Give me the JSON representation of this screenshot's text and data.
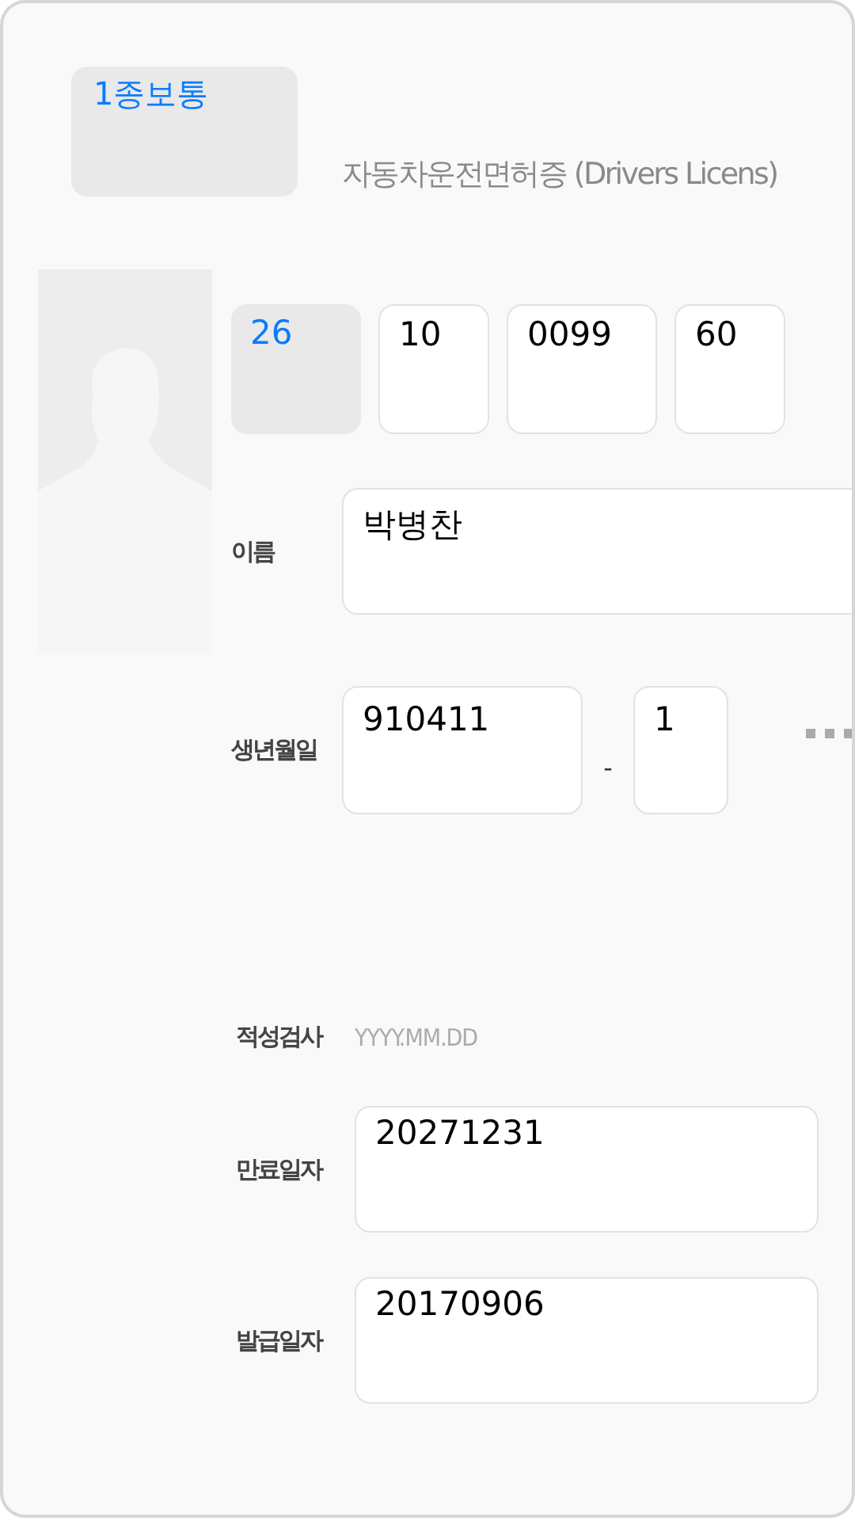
{
  "license_class": {
    "value": "1종보통",
    "kind": "select"
  },
  "title": "자동차운전면허증 (Drivers Licens)",
  "license_number": [
    {
      "value": "26",
      "kind": "select"
    },
    {
      "value": "10",
      "kind": "input"
    },
    {
      "value": "0099",
      "kind": "input"
    },
    {
      "value": "60",
      "kind": "input"
    }
  ],
  "name": {
    "label": "이름",
    "value": "박병찬"
  },
  "birth": {
    "label": "생년월일",
    "date": "910411",
    "separator": "-",
    "gender": "1"
  },
  "aptitude_test": {
    "label": "적성검사",
    "placeholder": "YYYY.MM.DD"
  },
  "expiry": {
    "label": "만료일자",
    "value": "20271231"
  },
  "issue": {
    "label": "발급일자",
    "value": "20170906"
  }
}
